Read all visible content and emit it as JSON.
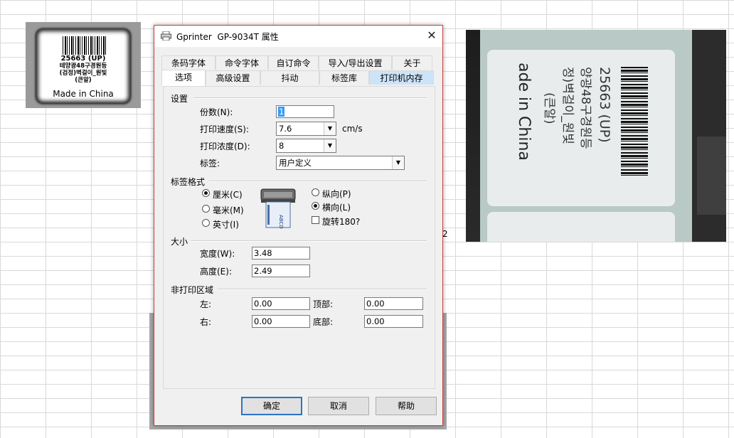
{
  "left_label": {
    "code": "25663  (UP)",
    "line1": "테양광48구경원등",
    "line2": "(검정)벽걸이_원빛",
    "line3": "(큰알)",
    "made_in": "Made in China"
  },
  "photo": {
    "code": "25663  (UP)",
    "line1": "양광48구경원등",
    "line2": "정)벽걸이_원빛",
    "line3": "(큰알)",
    "made_in": "ade in China"
  },
  "cell_fragment": "2",
  "dialog": {
    "title_app": "Gprinter",
    "title_model": "GP-9034T 属性",
    "tabs_back": [
      "条码字体",
      "命令字体",
      "自订命令",
      "导入/导出设置",
      "关于"
    ],
    "tabs_front": [
      "选项",
      "高级设置",
      "抖动",
      "标签库",
      "打印机内存"
    ],
    "settings": {
      "group": "设置",
      "copies_label": "份数(N):",
      "copies_value": "1",
      "speed_label": "打印速度(S):",
      "speed_value": "7.6",
      "speed_unit": "cm/s",
      "darkness_label": "打印浓度(D):",
      "darkness_value": "8",
      "stock_label": "标签:",
      "stock_value": "用户定义"
    },
    "format": {
      "group": "标签格式",
      "unit_inch_cm": "厘米(C)",
      "unit_mm": "毫米(M)",
      "unit_inch": "英寸(I)",
      "selected_unit": "厘米(C)",
      "portrait": "纵向(P)",
      "landscape": "横向(L)",
      "selected_orientation": "横向(L)",
      "rotate180": "旋转180?",
      "rotate180_checked": false,
      "graphic_text": "ABCD"
    },
    "size": {
      "group": "大小",
      "width_label": "宽度(W):",
      "width_value": "3.48",
      "height_label": "高度(E):",
      "height_value": "2.49"
    },
    "margins": {
      "group": "非打印区域",
      "left_label": "左:",
      "left_value": "0.00",
      "top_label": "顶部:",
      "top_value": "0.00",
      "right_label": "右:",
      "right_value": "0.00",
      "bottom_label": "底部:",
      "bottom_value": "0.00"
    },
    "buttons": {
      "ok": "确定",
      "cancel": "取消",
      "help": "帮助"
    },
    "colors": {
      "accent": "#2b74c7",
      "selection": "#3399ff",
      "border": "#c83e3e"
    }
  }
}
